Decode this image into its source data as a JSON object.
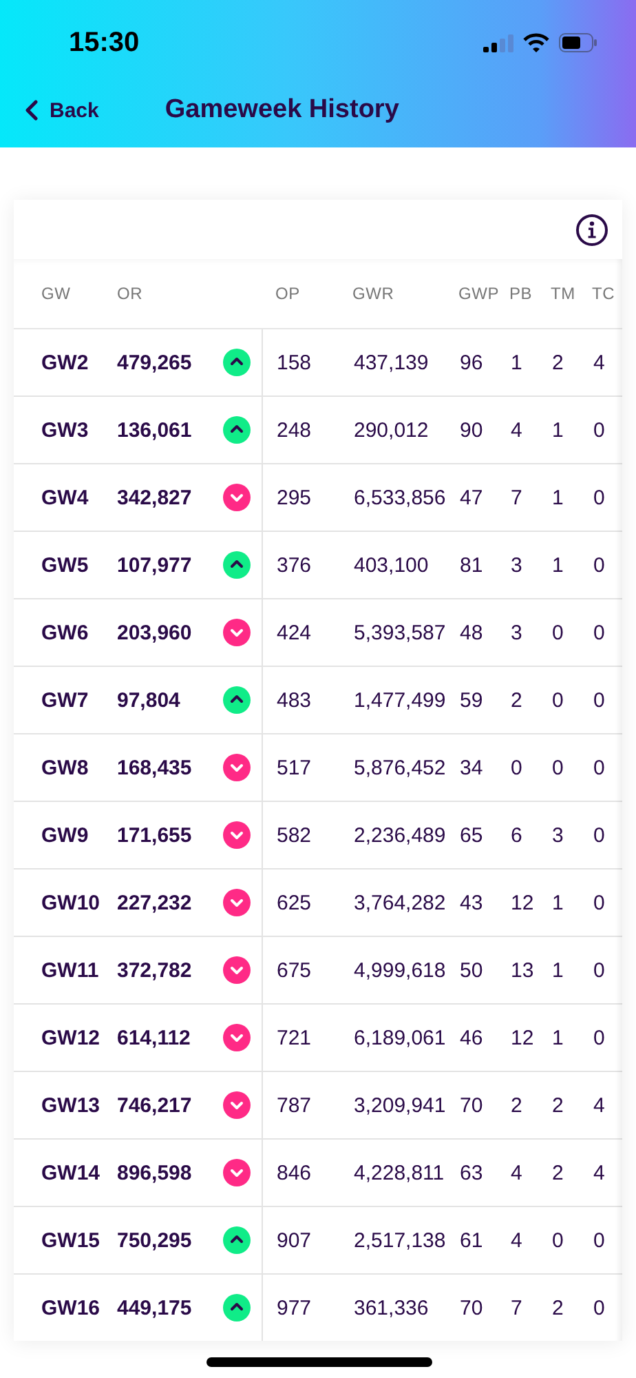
{
  "status_bar": {
    "time": "15:30"
  },
  "header": {
    "back_label": "Back",
    "title": "Gameweek History"
  },
  "table": {
    "columns": [
      "GW",
      "OR",
      "OP",
      "GWR",
      "GWP",
      "PB",
      "TM",
      "TC"
    ],
    "rows": [
      {
        "gw": "GW2",
        "or": "479,265",
        "rising": true,
        "op": "158",
        "gwr": "437,139",
        "gwp": "96",
        "pb": "1",
        "tm": "2",
        "tc": "4"
      },
      {
        "gw": "GW3",
        "or": "136,061",
        "rising": true,
        "op": "248",
        "gwr": "290,012",
        "gwp": "90",
        "pb": "4",
        "tm": "1",
        "tc": "0"
      },
      {
        "gw": "GW4",
        "or": "342,827",
        "rising": false,
        "op": "295",
        "gwr": "6,533,856",
        "gwp": "47",
        "pb": "7",
        "tm": "1",
        "tc": "0"
      },
      {
        "gw": "GW5",
        "or": "107,977",
        "rising": true,
        "op": "376",
        "gwr": "403,100",
        "gwp": "81",
        "pb": "3",
        "tm": "1",
        "tc": "0"
      },
      {
        "gw": "GW6",
        "or": "203,960",
        "rising": false,
        "op": "424",
        "gwr": "5,393,587",
        "gwp": "48",
        "pb": "3",
        "tm": "0",
        "tc": "0"
      },
      {
        "gw": "GW7",
        "or": "97,804",
        "rising": true,
        "op": "483",
        "gwr": "1,477,499",
        "gwp": "59",
        "pb": "2",
        "tm": "0",
        "tc": "0"
      },
      {
        "gw": "GW8",
        "or": "168,435",
        "rising": false,
        "op": "517",
        "gwr": "5,876,452",
        "gwp": "34",
        "pb": "0",
        "tm": "0",
        "tc": "0"
      },
      {
        "gw": "GW9",
        "or": "171,655",
        "rising": false,
        "op": "582",
        "gwr": "2,236,489",
        "gwp": "65",
        "pb": "6",
        "tm": "3",
        "tc": "0"
      },
      {
        "gw": "GW10",
        "or": "227,232",
        "rising": false,
        "op": "625",
        "gwr": "3,764,282",
        "gwp": "43",
        "pb": "12",
        "tm": "1",
        "tc": "0"
      },
      {
        "gw": "GW11",
        "or": "372,782",
        "rising": false,
        "op": "675",
        "gwr": "4,999,618",
        "gwp": "50",
        "pb": "13",
        "tm": "1",
        "tc": "0"
      },
      {
        "gw": "GW12",
        "or": "614,112",
        "rising": false,
        "op": "721",
        "gwr": "6,189,061",
        "gwp": "46",
        "pb": "12",
        "tm": "1",
        "tc": "0"
      },
      {
        "gw": "GW13",
        "or": "746,217",
        "rising": false,
        "op": "787",
        "gwr": "3,209,941",
        "gwp": "70",
        "pb": "2",
        "tm": "2",
        "tc": "4"
      },
      {
        "gw": "GW14",
        "or": "896,598",
        "rising": false,
        "op": "846",
        "gwr": "4,228,811",
        "gwp": "63",
        "pb": "4",
        "tm": "2",
        "tc": "4"
      },
      {
        "gw": "GW15",
        "or": "750,295",
        "rising": true,
        "op": "907",
        "gwr": "2,517,138",
        "gwp": "61",
        "pb": "4",
        "tm": "0",
        "tc": "0"
      },
      {
        "gw": "GW16",
        "or": "449,175",
        "rising": true,
        "op": "977",
        "gwr": "361,336",
        "gwp": "70",
        "pb": "7",
        "tm": "2",
        "tc": "0"
      }
    ]
  }
}
